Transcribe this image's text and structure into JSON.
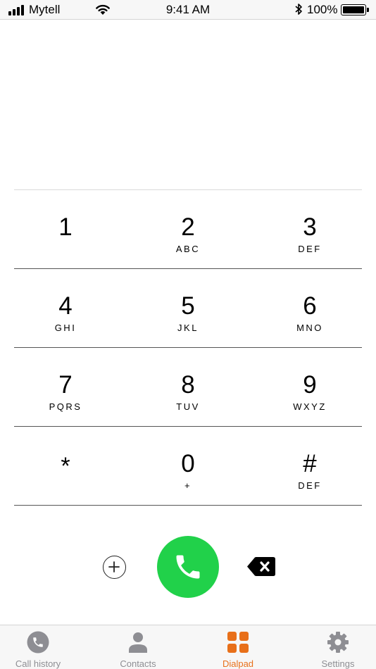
{
  "status_bar": {
    "carrier": "Mytell",
    "time": "9:41 AM",
    "battery": "100%",
    "icons": [
      "signal-icon",
      "wifi-icon",
      "bluetooth-icon",
      "battery-icon"
    ]
  },
  "dialed_number": "",
  "keypad": {
    "rows": [
      [
        {
          "digit": "1",
          "letters": ""
        },
        {
          "digit": "2",
          "letters": "ABC"
        },
        {
          "digit": "3",
          "letters": "DEF"
        }
      ],
      [
        {
          "digit": "4",
          "letters": "GHI"
        },
        {
          "digit": "5",
          "letters": "JKL"
        },
        {
          "digit": "6",
          "letters": "MNO"
        }
      ],
      [
        {
          "digit": "7",
          "letters": "PQRS"
        },
        {
          "digit": "8",
          "letters": "TUV"
        },
        {
          "digit": "9",
          "letters": "WXYZ"
        }
      ],
      [
        {
          "digit": "*",
          "letters": ""
        },
        {
          "digit": "0",
          "letters": "+"
        },
        {
          "digit": "#",
          "letters": "DEF"
        }
      ]
    ]
  },
  "actions": {
    "add_icon": "plus-circle-icon",
    "call_icon": "phone-icon",
    "delete_icon": "backspace-icon",
    "call_color": "#21d14a"
  },
  "tab_bar": {
    "active_color": "#e8701a",
    "inactive_color": "#8e8e93",
    "tabs": [
      {
        "label": "Call history",
        "icon": "phone-circle-icon",
        "active": false
      },
      {
        "label": "Contacts",
        "icon": "person-icon",
        "active": false
      },
      {
        "label": "Dialpad",
        "icon": "dialpad-icon",
        "active": true
      },
      {
        "label": "Settings",
        "icon": "gear-icon",
        "active": false
      }
    ]
  }
}
